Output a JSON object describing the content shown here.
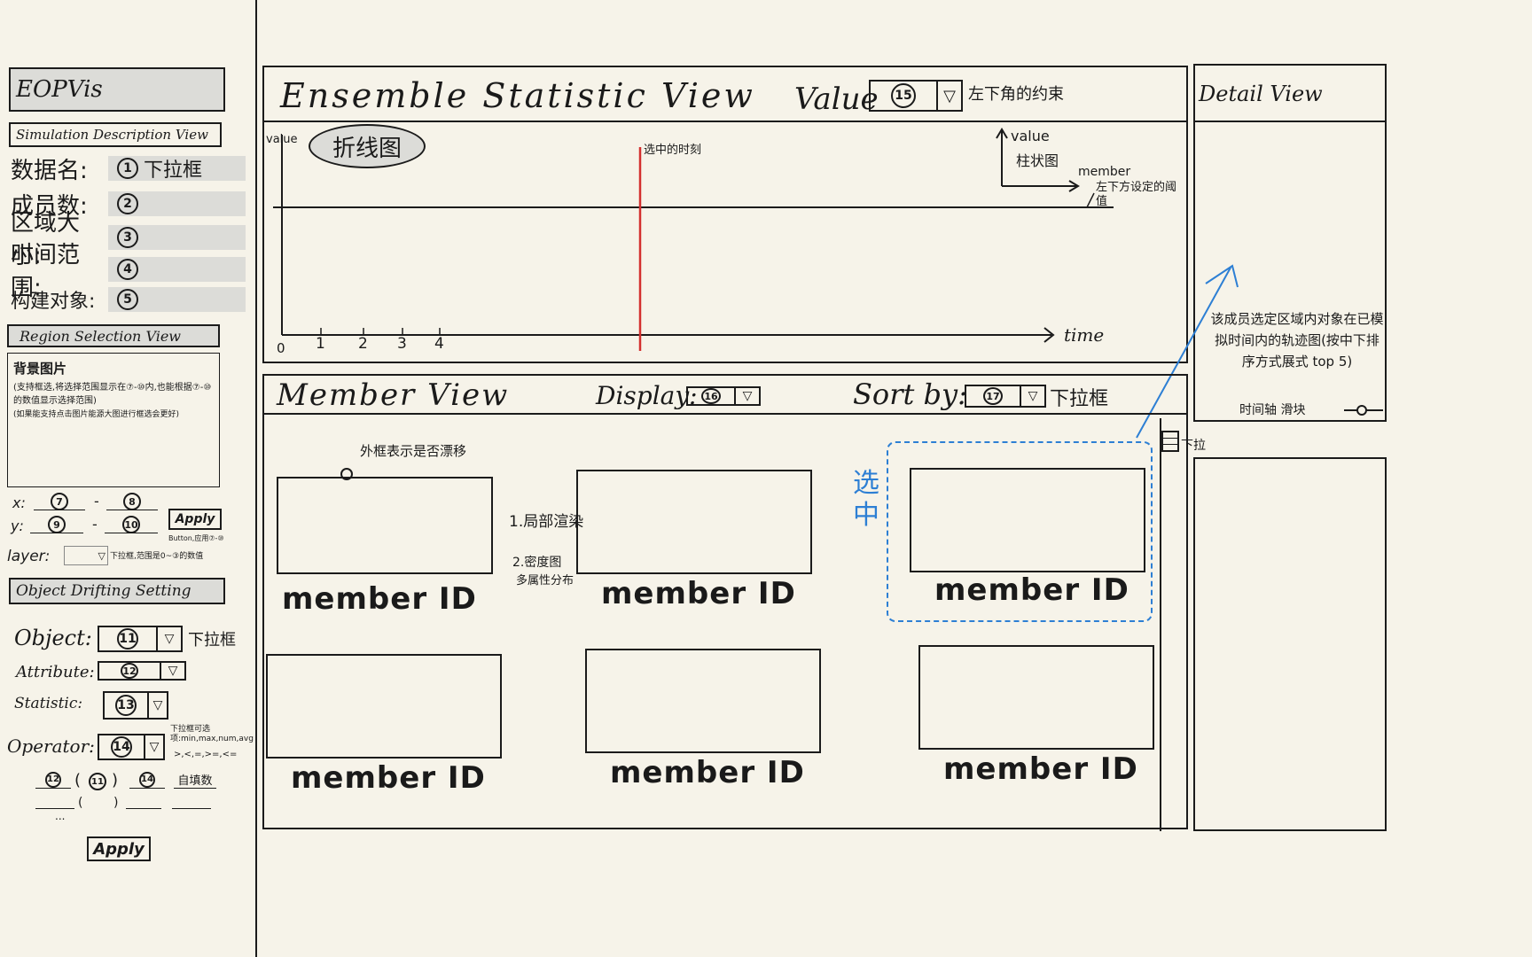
{
  "sidebar": {
    "app_title": "EOPVis",
    "sim_desc": {
      "header": "Simulation Description View",
      "rows": [
        {
          "label": "数据名:",
          "num": "1",
          "text": "下拉框"
        },
        {
          "label": "成员数:",
          "num": "2",
          "text": ""
        },
        {
          "label": "区域大小:",
          "num": "3",
          "text": ""
        },
        {
          "label": "时间范围:",
          "num": "4",
          "text": ""
        },
        {
          "label": "构建对象:",
          "num": "5",
          "text": ""
        }
      ]
    },
    "region": {
      "header": "Region Selection View",
      "bg_label": "背景图片",
      "note1": "(支持框选,将选择范围显示在⑦-⑩内,也能根据⑦-⑩的数值显示选择范围)",
      "note2": "(如果能支持点击图片能源大图进行框选会更好)",
      "x_label": "x:",
      "y_label": "y:",
      "x_from": "7",
      "x_to": "8",
      "y_from": "9",
      "y_to": "10",
      "dash": "-",
      "apply_label": "Apply",
      "apply_note": "Button,应用⑦-⑩",
      "layer_label": "layer:",
      "layer_note": "下拉框,范围是0~③的数值",
      "dropdown_glyph": "▽"
    },
    "drift": {
      "header": "Object Drifting Setting",
      "object_label": "Object:",
      "object_num": "11",
      "object_note": "下拉框",
      "attribute_label": "Attribute:",
      "attribute_num": "12",
      "statistic_label": "Statistic:",
      "statistic_num": "13",
      "statistic_note": "下拉框可选项:min,max,num,avg",
      "operator_label": "Operator:",
      "operator_num": "14",
      "operator_note": ">,<,=,>=,<=",
      "expr_a": "12",
      "expr_b": "11",
      "expr_c": "14",
      "expr_self": "自填数",
      "expr_paren_open": "(",
      "expr_paren_close": ")",
      "ellipsis": "...",
      "apply_label": "Apply"
    }
  },
  "ensemble": {
    "title": "Ensemble Statistic View",
    "value_label": "Value",
    "value_num": "15",
    "value_note": "左下角的约束",
    "chart_type_label": "折线图",
    "y_axis_label": "value",
    "x_axis_label": "time",
    "ticks": [
      "0",
      "1",
      "2",
      "3",
      "4"
    ],
    "selected_time_note": "选中的时刻",
    "legend_value": "value",
    "legend_bar": "柱状图",
    "legend_member": "member",
    "threshold_note": "左下方设定的阈值"
  },
  "member_view": {
    "title": "Member View",
    "display_label": "Display:",
    "display_num": "16",
    "sort_label": "Sort by:",
    "sort_num": "17",
    "sort_note": "下拉框",
    "frame_note": "外框表示是否漂移",
    "render_note1": "1.局部渲染",
    "render_note2": "2.密度图",
    "render_note3": "多属性分布",
    "selected_note": "选中",
    "scroll_note": "下拉",
    "card_label": "member ID"
  },
  "detail": {
    "title": "Detail View",
    "note": "该成员选定区域内对象在已模拟时间内的轨迹图(按中下排序方式展式 top 5)",
    "slider_label": "时间轴 滑块"
  },
  "colors": {
    "background": "#f6f3e9",
    "ink": "#1b1b1b",
    "selected_time": "#d32f2f",
    "annotation_blue": "#2d7fd4",
    "gray_fill": "#dcdcd8"
  }
}
